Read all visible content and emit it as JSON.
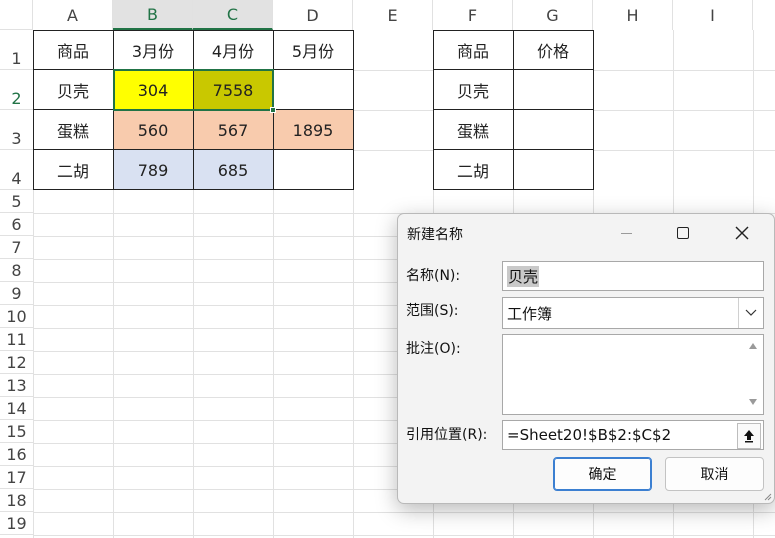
{
  "columns": [
    "A",
    "B",
    "C",
    "D",
    "E",
    "F",
    "G",
    "H",
    "I"
  ],
  "rows": [
    "1",
    "2",
    "3",
    "4",
    "5",
    "6",
    "7",
    "8",
    "9",
    "10",
    "11",
    "12",
    "13",
    "14",
    "15",
    "16",
    "17",
    "18",
    "19"
  ],
  "table1": {
    "header": [
      "商品",
      "3月份",
      "4月份",
      "5月份"
    ],
    "rows": [
      [
        "贝壳",
        "304",
        "7558",
        ""
      ],
      [
        "蛋糕",
        "560",
        "567",
        "1895"
      ],
      [
        "二胡",
        "789",
        "685",
        ""
      ]
    ]
  },
  "table2": {
    "header": [
      "商品",
      "价格"
    ],
    "items": [
      "贝壳",
      "蛋糕",
      "二胡"
    ]
  },
  "colors": {
    "yellow": "#ffff00",
    "olive": "#c9c800",
    "peach": "#f8cbad",
    "lavender": "#d9e1f2",
    "selection_green": "#217346"
  },
  "dialog": {
    "title": "新建名称",
    "minimize_icon": "minimize-icon",
    "maximize_icon": "maximize-icon",
    "close_icon": "close-icon",
    "name_label": "名称(N):",
    "name_value": "贝壳",
    "scope_label": "范围(S):",
    "scope_value": "工作簿",
    "comment_label": "批注(O):",
    "comment_value": "",
    "ref_label": "引用位置(R):",
    "ref_value": "=Sheet20!$B$2:$C$2",
    "ok_label": "确定",
    "cancel_label": "取消"
  }
}
